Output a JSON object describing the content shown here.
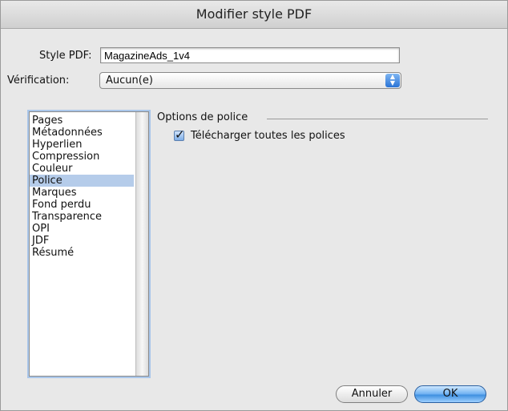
{
  "window": {
    "title": "Modifier style PDF"
  },
  "form": {
    "style_label": "Style PDF:",
    "style_value": "MagazineAds_1v4",
    "verification_label": "Vérification:",
    "verification_value": "Aucun(e)"
  },
  "sidebar": {
    "items": [
      {
        "label": "Pages"
      },
      {
        "label": "Métadonnées"
      },
      {
        "label": "Hyperlien"
      },
      {
        "label": "Compression"
      },
      {
        "label": "Couleur"
      },
      {
        "label": "Police",
        "selected": true
      },
      {
        "label": "Marques"
      },
      {
        "label": "Fond perdu"
      },
      {
        "label": "Transparence"
      },
      {
        "label": "OPI"
      },
      {
        "label": "JDF"
      },
      {
        "label": "Résumé"
      }
    ]
  },
  "panel": {
    "section_title": "Options de police",
    "checkbox_label": "Télécharger toutes les polices",
    "checkbox_checked": true
  },
  "buttons": {
    "cancel": "Annuler",
    "ok": "OK"
  },
  "colors": {
    "selection": "#b5ccea",
    "accent": "#3e8fe0"
  }
}
